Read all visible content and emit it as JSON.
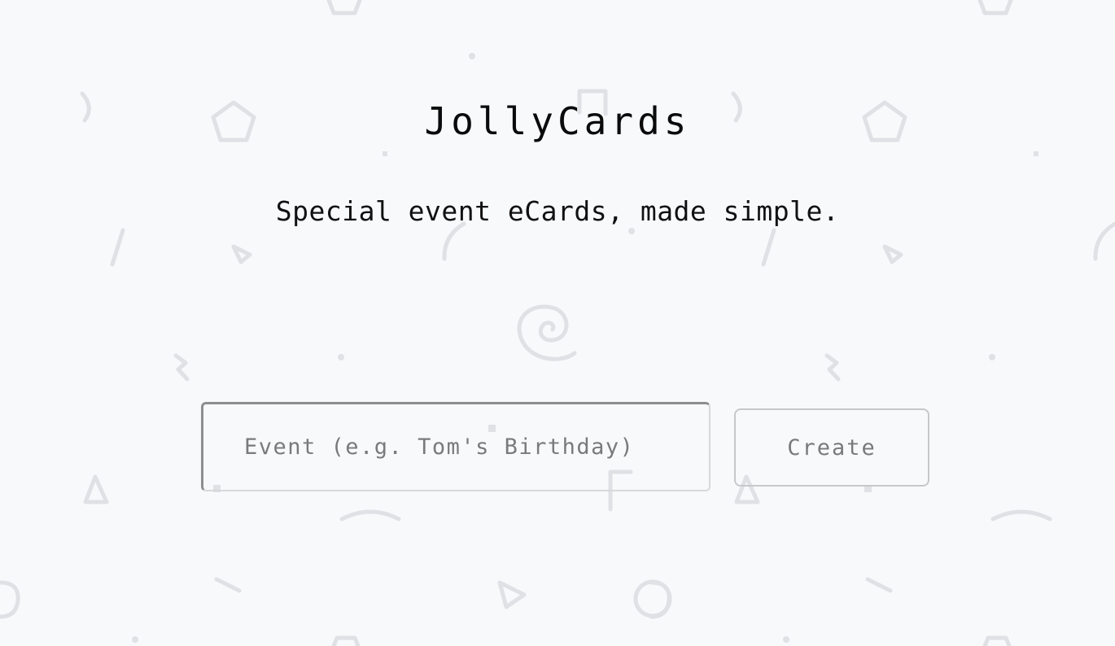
{
  "header": {
    "title": "JollyCards",
    "tagline": "Special event eCards, made simple."
  },
  "form": {
    "event_placeholder": "Event (e.g. Tom's Birthday)",
    "event_value": "",
    "create_label": "Create"
  },
  "colors": {
    "background": "#f8f9fb",
    "pattern_stroke": "#dfe1e5",
    "title_text": "#0b0b0b",
    "muted_text": "#7a7a7a"
  }
}
